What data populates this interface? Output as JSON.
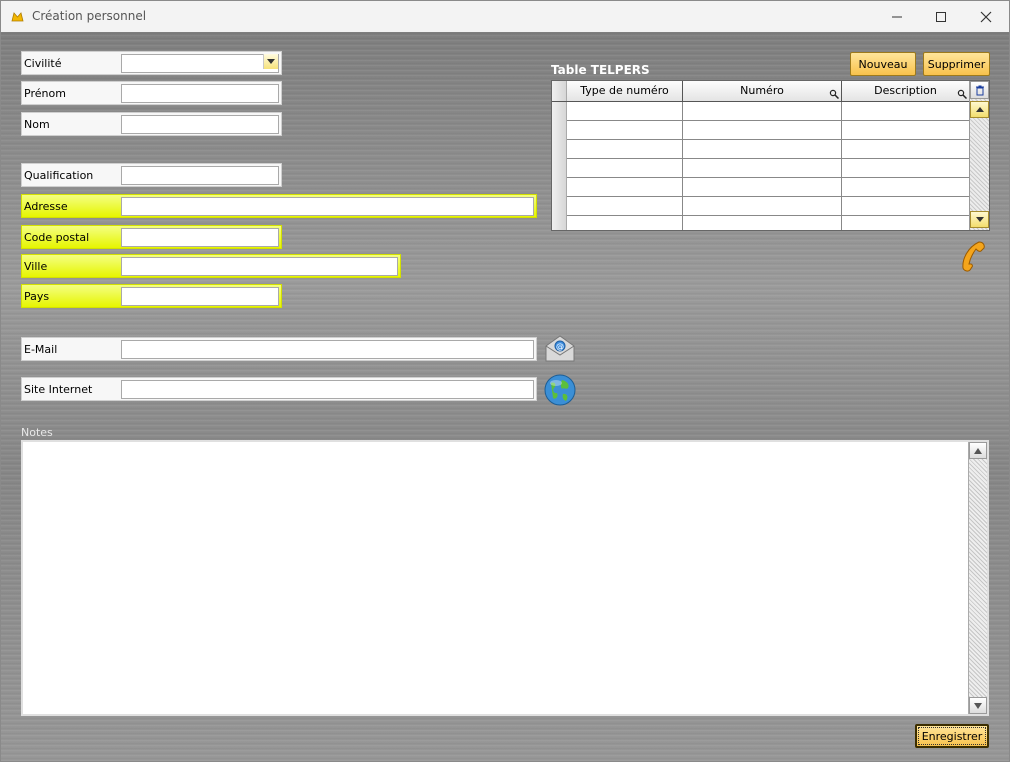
{
  "window": {
    "title": "Création personnel",
    "controls": {
      "minimize": "—",
      "maximize": "☐",
      "close": "✕"
    }
  },
  "form": {
    "civilite": {
      "label": "Civilité",
      "value": ""
    },
    "prenom": {
      "label": "Prénom",
      "value": ""
    },
    "nom": {
      "label": "Nom",
      "value": ""
    },
    "qualification": {
      "label": "Qualification",
      "value": ""
    },
    "adresse": {
      "label": "Adresse",
      "value": ""
    },
    "code_postal": {
      "label": "Code postal",
      "value": ""
    },
    "ville": {
      "label": "Ville",
      "value": ""
    },
    "pays": {
      "label": "Pays",
      "value": ""
    },
    "email": {
      "label": "E-Mail",
      "value": ""
    },
    "site": {
      "label": "Site Internet",
      "value": ""
    },
    "notes": {
      "label": "Notes",
      "value": ""
    }
  },
  "table": {
    "title": "Table TELPERS",
    "columns": [
      "Type de numéro",
      "Numéro",
      "Description"
    ],
    "rows": [
      [
        "",
        "",
        ""
      ],
      [
        "",
        "",
        ""
      ],
      [
        "",
        "",
        ""
      ],
      [
        "",
        "",
        ""
      ],
      [
        "",
        "",
        ""
      ],
      [
        "",
        "",
        ""
      ]
    ]
  },
  "buttons": {
    "nouveau": "Nouveau",
    "supprimer": "Supprimer",
    "enregistrer": "Enregistrer"
  },
  "icons": {
    "app": "app-icon",
    "email": "email-icon",
    "globe": "globe-icon",
    "phone": "phone-icon",
    "delete_column": "trash-icon",
    "search": "magnifier-icon"
  },
  "colors": {
    "required_field": "#e6f500",
    "button_gold": "#f8c24c",
    "background_metal": "#8c8c8c"
  }
}
